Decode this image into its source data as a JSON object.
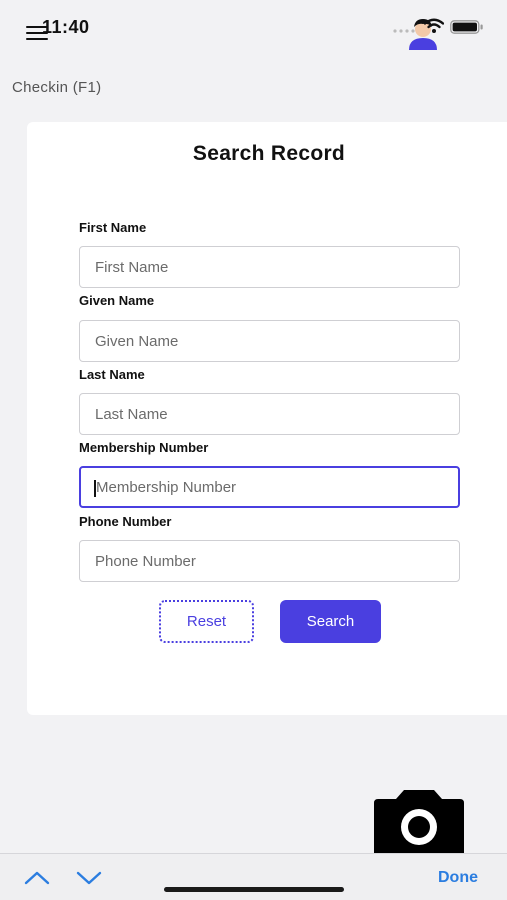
{
  "status_bar": {
    "time": "11:40"
  },
  "page": {
    "title": "Checkin (F1)"
  },
  "form": {
    "title": "Search Record",
    "fields": [
      {
        "label": "First Name",
        "placeholder": "First Name",
        "value": ""
      },
      {
        "label": "Given Name",
        "placeholder": "Given Name",
        "value": ""
      },
      {
        "label": "Last Name",
        "placeholder": "Last Name",
        "value": ""
      },
      {
        "label": "Membership Number",
        "placeholder": "Membership Number",
        "value": "",
        "focused": true
      },
      {
        "label": "Phone Number",
        "placeholder": "Phone Number",
        "value": ""
      }
    ],
    "reset_label": "Reset",
    "search_label": "Search"
  },
  "keyboard_toolbar": {
    "done_label": "Done"
  },
  "colors": {
    "accent": "#4a3fe0",
    "done": "#2b7de0",
    "background": "#f2f2f4"
  },
  "icons": [
    "menu-icon",
    "avatar-icon",
    "wifi-icon",
    "battery-icon",
    "camera-icon",
    "chevron-up-icon",
    "chevron-down-icon"
  ]
}
